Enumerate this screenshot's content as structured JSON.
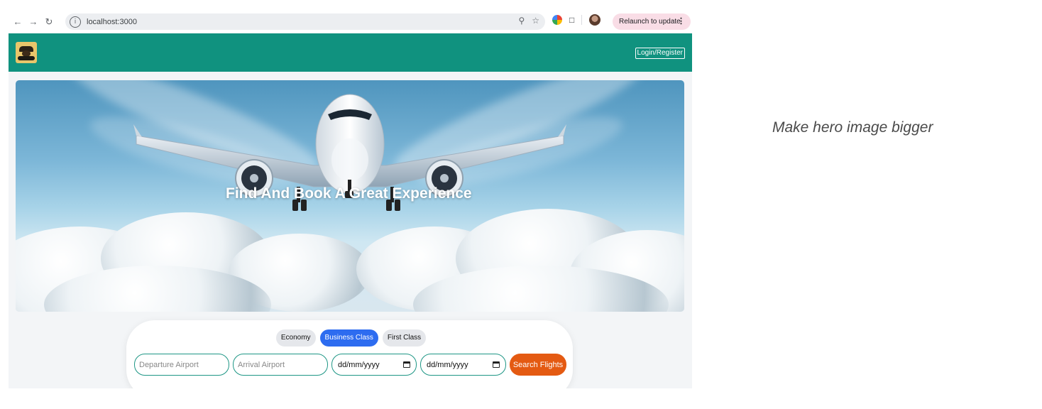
{
  "browser": {
    "url": "localhost:3000",
    "relaunch_label": "Relaunch to update"
  },
  "header": {
    "login_label": "Login/Register"
  },
  "hero": {
    "title": "Find And Book A Great Experience"
  },
  "search": {
    "classes": [
      "Economy",
      "Business Class",
      "First Class"
    ],
    "active_class": "Business Class",
    "departure_placeholder": "Departure Airport",
    "arrival_placeholder": "Arrival Airport",
    "date_format": "dd/mm/yyyy",
    "search_label": "Search Flights"
  },
  "annotation": {
    "text": "Make hero image bigger"
  },
  "colors": {
    "header_bg": "#10927f",
    "active_tab": "#2d6cf0",
    "search_button": "#e45a12",
    "field_border": "#1e9685"
  }
}
